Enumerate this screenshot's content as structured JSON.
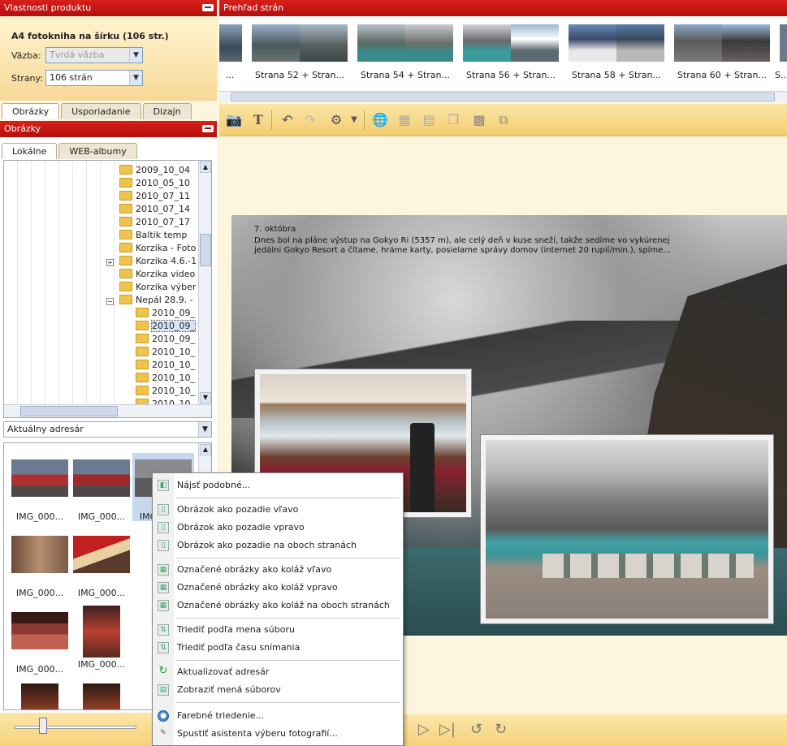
{
  "product_panel": {
    "header": "Vlastnosti produktu",
    "title": "A4 fotokniha na šírku (106 str.)",
    "binding_label": "Väzba:",
    "binding_value": "Tvrdá väzba",
    "pages_label": "Strany:",
    "pages_value": "106 strán"
  },
  "left_tabs": [
    "Obrázky",
    "Usporiadanie",
    "Dizajn"
  ],
  "images_panel": {
    "header": "Obrázky",
    "source_tabs": [
      "Lokálne",
      "WEB-albumy"
    ],
    "tree": [
      "2009_10_04",
      "2010_05_10",
      "2010_07_11",
      "2010_07_14",
      "2010_07_17",
      "Baltik temp",
      "Korzika - Foto",
      "Korzika 4.6.-1",
      "Korzika video",
      "Korzika výber",
      "Nepál 28.9. -",
      "2010_09_",
      "2010_09_",
      "2010_09_",
      "2010_10_",
      "2010_10_",
      "2010_10_",
      "2010_10_",
      "2010_10_"
    ],
    "address": "Aktuálny adresár",
    "thumb_caption": "IMG_000..."
  },
  "pages_overview": {
    "header": "Prehľad strán",
    "first_caption": "...",
    "captions": [
      "Strana 52 + Stran...",
      "Strana 54 + Stran...",
      "Strana 56 + Stran...",
      "Strana 58 + Stran...",
      "Strana 60 + Stran...",
      "S..."
    ]
  },
  "toolbar_icons": [
    "camera-icon",
    "text-icon",
    "undo-icon",
    "redo-icon",
    "effects-icon",
    "globe-icon",
    "page-icon",
    "layout-icon",
    "copy-icon",
    "grid-icon",
    "arrange-icon"
  ],
  "spread_text": {
    "date": "7. októbra",
    "line1": "Dnes bol na pláne výstup na Gokyo Ri (5357 m), ale celý deň v kuse sneží, takže sedíme vo vykúrenej",
    "line2": "jedálni Gokyo Resort a čítame, hráme karty, posielame správy domov (internet 20 rupií/min.), spíme..."
  },
  "context_menu": {
    "items": [
      {
        "label": "Nájsť podobné...",
        "icon": "find-similar-icon"
      },
      {
        "label": "Obrázok ako pozadie vľavo",
        "icon": "bg-left-icon"
      },
      {
        "label": "Obrázok ako pozadie vpravo",
        "icon": "bg-right-icon"
      },
      {
        "label": "Obrázok ako pozadie na oboch stranách",
        "icon": "bg-both-icon"
      },
      {
        "label": "Označené obrázky ako koláž vľavo",
        "icon": "collage-left-icon"
      },
      {
        "label": "Označené obrázky ako koláž vpravo",
        "icon": "collage-right-icon"
      },
      {
        "label": "Označené obrázky ako koláž na oboch stranách",
        "icon": "collage-both-icon"
      },
      {
        "label": "Triediť podľa mena súboru",
        "icon": "sort-name-icon"
      },
      {
        "label": "Triediť podľa času snímania",
        "icon": "sort-time-icon"
      },
      {
        "label": "Aktualizovať adresár",
        "icon": "refresh-icon"
      },
      {
        "label": "Zobraziť mená súborov",
        "icon": "show-names-icon"
      },
      {
        "label": "Farebné triedenie...",
        "icon": "color-sort-icon"
      },
      {
        "label": "Spustiť asistenta výberu fotografií...",
        "icon": "assistant-icon"
      }
    ]
  }
}
